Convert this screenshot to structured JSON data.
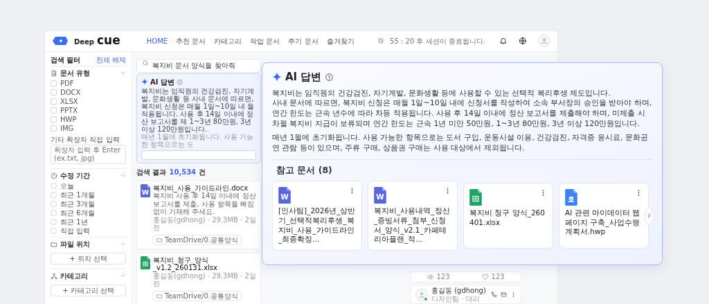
{
  "header": {
    "logo_small": "Deep",
    "logo_big": "cue",
    "nav": [
      {
        "label": "HOME",
        "selected": true
      },
      {
        "label": "추천 문서",
        "selected": false
      },
      {
        "label": "카테고리",
        "selected": false
      },
      {
        "label": "작업 문서",
        "selected": false
      },
      {
        "label": "주기 문서",
        "selected": false
      },
      {
        "label": "즐겨찾기",
        "selected": false
      }
    ],
    "session": "55 : 20 후 세션이 종료됩니다."
  },
  "filters": {
    "title": "검색 필터",
    "clear": "전체 해제",
    "sections": [
      {
        "kind": "checkbox",
        "title": "문서 유형",
        "options": [
          {
            "label": "PDF",
            "checked": false
          },
          {
            "label": "DOCX",
            "checked": false
          },
          {
            "label": "XLSX",
            "checked": false
          },
          {
            "label": "PPTX",
            "checked": false
          },
          {
            "label": "HWP",
            "checked": false
          },
          {
            "label": "IMG",
            "checked": false
          }
        ],
        "extra_label": "기타 확장자 직접 입력",
        "extra_placeholder": "확장자 입력 후 Enter (ex.txt, jpg)"
      },
      {
        "kind": "radio",
        "title": "수정 기간",
        "options": [
          {
            "label": "오늘",
            "selected": false
          },
          {
            "label": "최근 1개월",
            "selected": false
          },
          {
            "label": "최근 3개월",
            "selected": false
          },
          {
            "label": "최근 6개월",
            "selected": false
          },
          {
            "label": "최근 1년",
            "selected": false
          },
          {
            "label": "직접 입력",
            "selected": false
          }
        ]
      },
      {
        "kind": "button",
        "title": "파일 위치",
        "button": "+ 위치 선택"
      },
      {
        "kind": "button",
        "title": "카테고리",
        "button": "+ 카테고리 선택"
      }
    ]
  },
  "main": {
    "search": {
      "value": "복지비 문서 양식을 찾아줘"
    },
    "ai_preview": {
      "title": "AI 답변",
      "text": "복지비는 임직원의 건강검진, 자기계발, 문화생활 등 사내 문서에 따르면, 복지비 신청은 매월 1일~10일 내 을 적용됩니다. 사용 후 14일 이내에 정산 보고서를 제 1~3년 80만원, 3년 이상 120만원입니다.",
      "note": "매년 1월에 초기화됩니다. 사용 가능한 항목으로는 도"
    },
    "results_label": "검색 결과",
    "results_count": "10,534",
    "results_unit": "건",
    "results": [
      {
        "kind": "word",
        "badge": "W",
        "name": "복지비_사용_가이드라인.docx",
        "description": "복지비 사용 후 14일 이내에 정산 보고서를 제출, 사용 항목을 빠짐없이 기재해 주세요.",
        "meta": "홍길동(gdhong) · 29.3MB · 2일 전",
        "path": "TeamDrive/0.공통양식"
      },
      {
        "kind": "sheet",
        "name": "복지비_청구_양식_v1.2_260131.xlsx",
        "meta": "홍길동(gdhong) · 29.3MB · 2일 전",
        "path": "TeamDrive/0.공통양식"
      }
    ]
  },
  "side": {
    "stats": [
      {
        "kind": "views",
        "value": "123"
      },
      {
        "kind": "likes",
        "value": "123"
      }
    ],
    "person": {
      "name": "홍길동 (gdhong)",
      "dept": "디자인팀 · 대리",
      "online": true
    }
  },
  "ai_panel": {
    "title": "AI 답변",
    "paragraphs": [
      "복지비는 임직원의 건강검진, 자기계발, 문화생활 등에 사용할 수 있는 선택적 복리후생 제도입니다.\n사내 문서에 따르면, 복지비 신청은 매월 1일~10일 내에 신청서를 작성하여 소속 부서장의 승인을 받아야 하며, 연간 한도는 근속 년수에 따라 차등 적용됩니다. 사용 후 14일 이내에 정산 보고서를 제출해야 하며, 미제출 시 차월 복지비 지급이 보류되며 연간 한도는 근속 1년 미만 50만원, 1~3년 80만원, 3년 이상 120만원입니다.",
      "매년 1월에 초기화됩니다. 사용 가능한 항목으로는 도서 구입, 운동시설 이용, 건강검진, 자격증 응시료, 문화공연 관람 등이 있으며, 주류 구매, 상품권 구매는 사용 대상에서 제외됩니다."
    ],
    "refs_title": "참고 문서 (8)",
    "refs": [
      {
        "kind": "word",
        "badge": "W",
        "name": "[인사팀]_2026년_상반기_선택적복리후생_복지비_사용_가이드라인_최종확정..."
      },
      {
        "kind": "word",
        "badge": "W",
        "name": "복지비_사용내역_정산_증빙서류_첨부_신청서_양식_v2.1_카페테리아플랜_적..."
      },
      {
        "kind": "sheet",
        "name": "복지비 청구 양식_260401.xlsx"
      },
      {
        "kind": "hwp",
        "badge": "호",
        "name": "AI 관련 마이데이터 웹페이지 구축_사업수행계획서.hwp"
      }
    ]
  }
}
